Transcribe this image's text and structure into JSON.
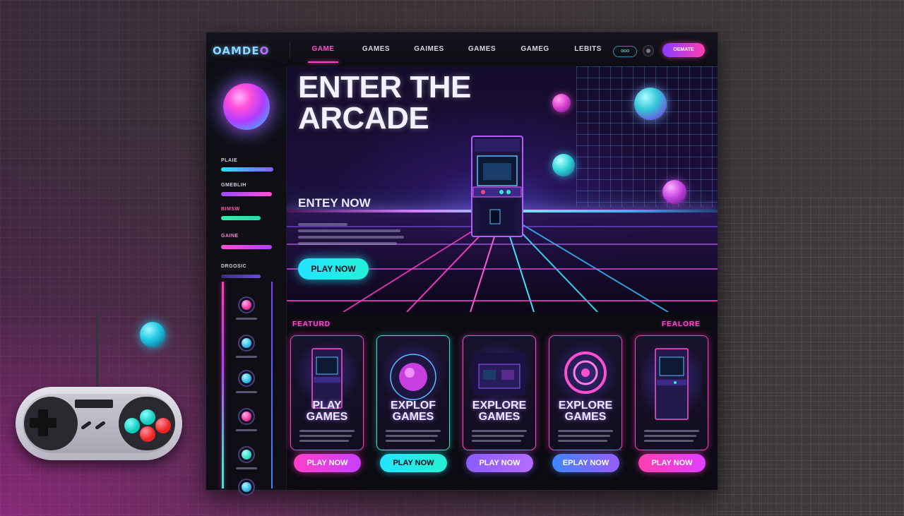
{
  "app": {
    "logo": "OAMDE",
    "logo_suffix": "O"
  },
  "nav": {
    "items": [
      {
        "label": "GAME",
        "active": true
      },
      {
        "label": "GAMES",
        "active": false
      },
      {
        "label": "GAIMES",
        "active": false
      },
      {
        "label": "GAMES",
        "active": false
      },
      {
        "label": "GAMEG",
        "active": false
      },
      {
        "label": "LEBITS",
        "active": false
      }
    ],
    "pill": "ooo",
    "cta": "OEMATE"
  },
  "sidebar": {
    "items": [
      {
        "label": "PLAIE"
      },
      {
        "label": "GMEBLIH"
      },
      {
        "label": "BIMSW"
      },
      {
        "label": "GAINE"
      },
      {
        "label": "DRGOSIC"
      }
    ]
  },
  "hero": {
    "title": "ENTER THE\nARCADE",
    "subtitle": "ENTEY NOW",
    "cta": "PLAY NOW"
  },
  "featured": {
    "left_label": "FEATURD",
    "right_label": "FEALORE",
    "cards": [
      {
        "title": "PLAY\nGAMES",
        "button": "PLAY NOW"
      },
      {
        "title": "EXPLOF\nGAMES",
        "button": "PLAY NOW"
      },
      {
        "title": "EXPLORE\nGAMES",
        "button": "PLAY NOW"
      },
      {
        "title": "EXPLORE\nGAMES",
        "button": "EPLAY NOW"
      },
      {
        "title": "",
        "button": "PLAY NOW"
      }
    ]
  },
  "colors": {
    "accent_pink": "#ff3fc8",
    "accent_cyan": "#24e4ff",
    "accent_purple": "#8a3cff"
  }
}
